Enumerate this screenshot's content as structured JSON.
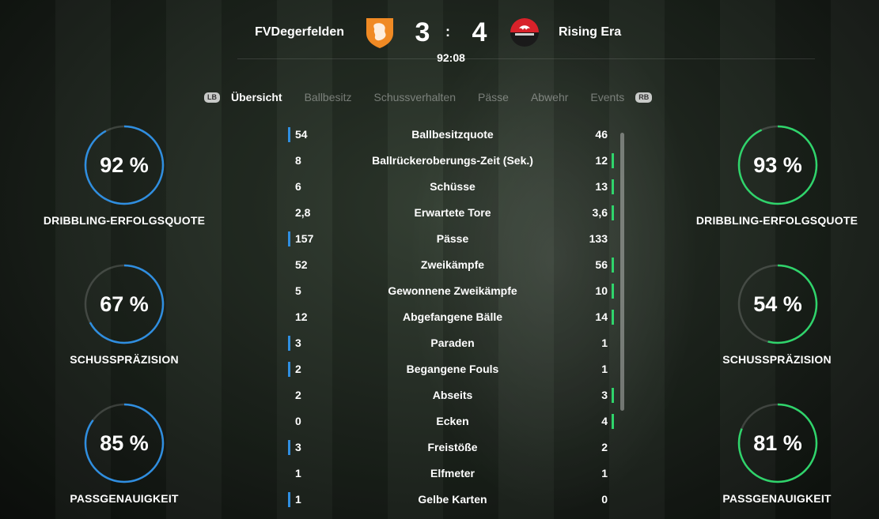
{
  "header": {
    "home_team": "FVDegerfelden",
    "away_team": "Rising Era",
    "home_score": "3",
    "away_score": "4",
    "separator": ":",
    "clock": "92:08"
  },
  "tabs": {
    "left_bumper": "LB",
    "right_bumper": "RB",
    "items": [
      "Übersicht",
      "Ballbesitz",
      "Schussverhalten",
      "Pässe",
      "Abwehr",
      "Events"
    ],
    "active": "Übersicht"
  },
  "left_rings": [
    {
      "value": "92 %",
      "percent": 92,
      "label": "DRIBBLING-ERFOLGSQUOTE"
    },
    {
      "value": "67 %",
      "percent": 67,
      "label": "SCHUSSPRÄZISION"
    },
    {
      "value": "85 %",
      "percent": 85,
      "label": "PASSGENAUIGKEIT"
    }
  ],
  "right_rings": [
    {
      "value": "93 %",
      "percent": 93,
      "label": "DRIBBLING-ERFOLGSQUOTE"
    },
    {
      "value": "54 %",
      "percent": 54,
      "label": "SCHUSSPRÄZISION"
    },
    {
      "value": "81 %",
      "percent": 81,
      "label": "PASSGENAUIGKEIT"
    }
  ],
  "stats": [
    {
      "name": "Ballbesitzquote",
      "home": "54",
      "away": "46",
      "leader": "home"
    },
    {
      "name": "Ballrückeroberungs-Zeit (Sek.)",
      "home": "8",
      "away": "12",
      "leader": "away"
    },
    {
      "name": "Schüsse",
      "home": "6",
      "away": "13",
      "leader": "away"
    },
    {
      "name": "Erwartete Tore",
      "home": "2,8",
      "away": "3,6",
      "leader": "away"
    },
    {
      "name": "Pässe",
      "home": "157",
      "away": "133",
      "leader": "home"
    },
    {
      "name": "Zweikämpfe",
      "home": "52",
      "away": "56",
      "leader": "away"
    },
    {
      "name": "Gewonnene Zweikämpfe",
      "home": "5",
      "away": "10",
      "leader": "away"
    },
    {
      "name": "Abgefangene Bälle",
      "home": "12",
      "away": "14",
      "leader": "away"
    },
    {
      "name": "Paraden",
      "home": "3",
      "away": "1",
      "leader": "home"
    },
    {
      "name": "Begangene Fouls",
      "home": "2",
      "away": "1",
      "leader": "home"
    },
    {
      "name": "Abseits",
      "home": "2",
      "away": "3",
      "leader": "away"
    },
    {
      "name": "Ecken",
      "home": "0",
      "away": "4",
      "leader": "away"
    },
    {
      "name": "Freistöße",
      "home": "3",
      "away": "2",
      "leader": "home"
    },
    {
      "name": "Elfmeter",
      "home": "1",
      "away": "1",
      "leader": "none"
    },
    {
      "name": "Gelbe Karten",
      "home": "1",
      "away": "0",
      "leader": "home"
    }
  ],
  "colors": {
    "home_accent": "#2f8ee0",
    "away_accent": "#2fd46b",
    "home_crest": "#f08a24",
    "away_crest": "#d8222a"
  }
}
